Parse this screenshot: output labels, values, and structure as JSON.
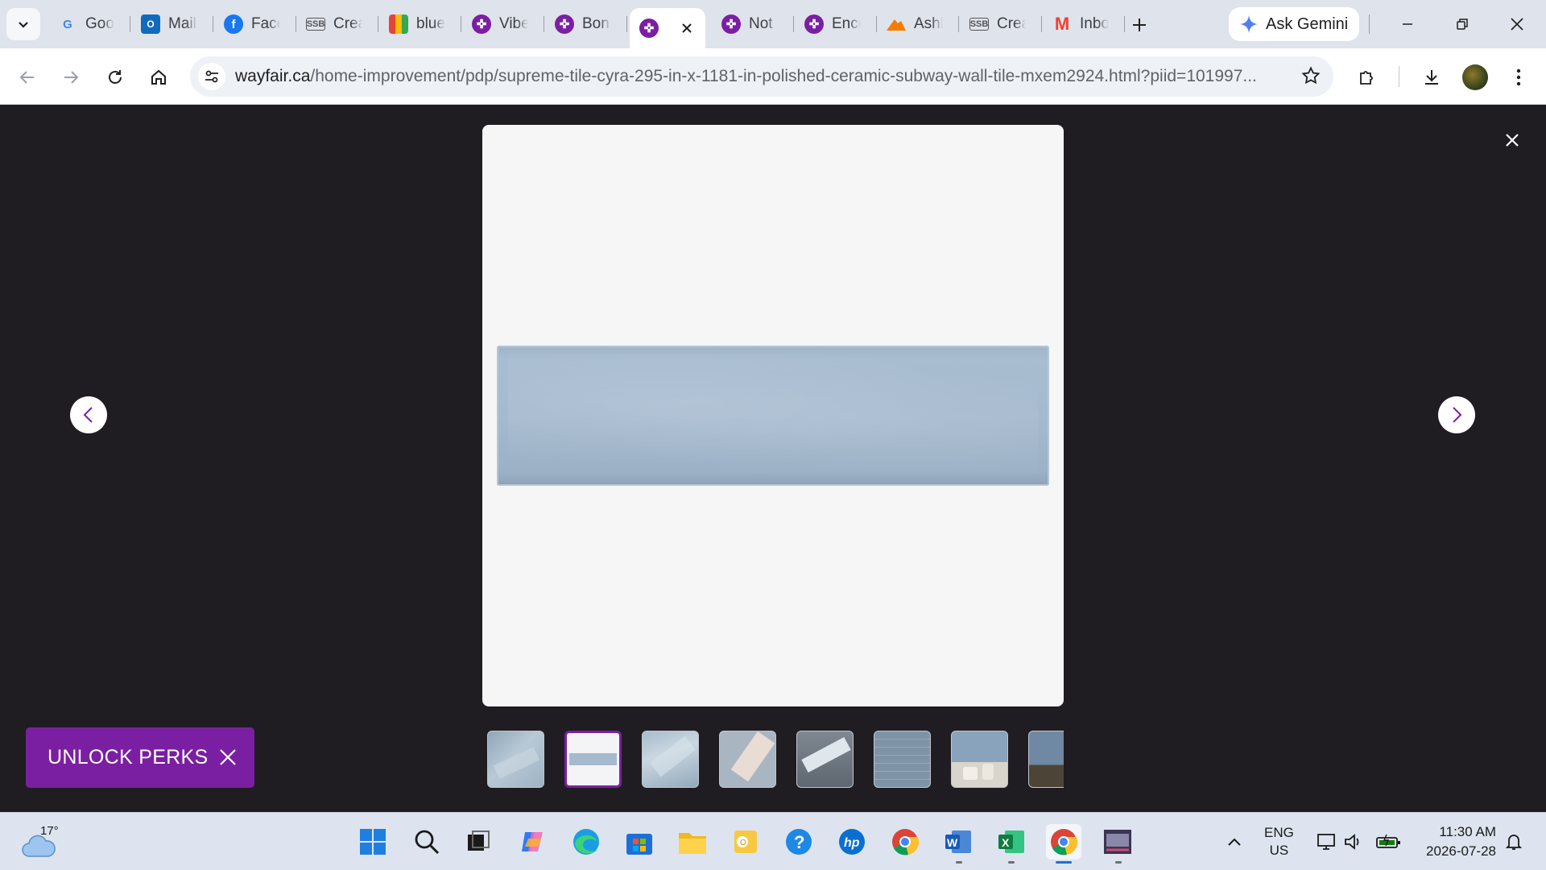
{
  "browser": {
    "tabs": [
      {
        "title": "Goo",
        "icon": "google-icon"
      },
      {
        "title": "Mail",
        "icon": "outlook-icon"
      },
      {
        "title": "Face",
        "icon": "facebook-icon"
      },
      {
        "title": "Crea",
        "icon": "ssb-icon"
      },
      {
        "title": "blue",
        "icon": "shopping-icon"
      },
      {
        "title": "Vibe",
        "icon": "wayfair-icon"
      },
      {
        "title": "Bon",
        "icon": "wayfair-icon"
      },
      {
        "title": "",
        "icon": "wayfair-icon",
        "active": true
      },
      {
        "title": "Not",
        "icon": "wayfair-icon"
      },
      {
        "title": "Enco",
        "icon": "wayfair-icon"
      },
      {
        "title": "Ashl",
        "icon": "ashley-icon"
      },
      {
        "title": "Crea",
        "icon": "ssb-icon"
      },
      {
        "title": "Inbo",
        "icon": "gmail-icon"
      }
    ],
    "gemini_label": "Ask Gemini",
    "url_host": "wayfair.ca",
    "url_path": "/home-improvement/pdp/supreme-tile-cyra-295-in-x-1181-in-polished-ceramic-subway-wall-tile-mxem2924.html?piid=101997..."
  },
  "gallery": {
    "perks_label": "UNLOCK PERKS",
    "selected_thumbnail": 2,
    "thumbnail_count_visible": 8
  },
  "taskbar": {
    "temperature": "17°",
    "lang_line1": "ENG",
    "lang_line2": "US",
    "time": "11:30 AM",
    "date": "2026-07-28"
  },
  "colors": {
    "accent": "#7b1fa2",
    "overlay": "#1f1d21",
    "tile": "#a6bacf"
  }
}
